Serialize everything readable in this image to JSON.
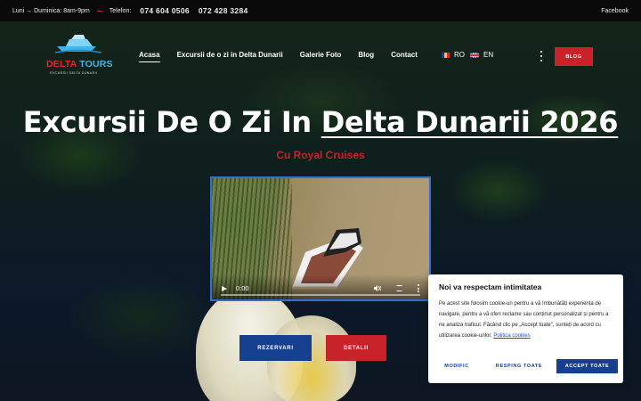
{
  "topbar": {
    "hours": "Luni → Duminica: 8am-9pm",
    "phone_label": "Telefon:",
    "phone1": "074 604 0506",
    "phone2": "072 428 3284",
    "facebook": "Facebook"
  },
  "logo": {
    "brand_part1": "DELTA",
    "brand_part2": "TOURS",
    "tagline": "EXCURSII DELTA DUNARII"
  },
  "nav": {
    "items": [
      {
        "label": "Acasa",
        "active": true
      },
      {
        "label": "Excursii de o zi in Delta Dunarii"
      },
      {
        "label": "Galerie Foto"
      },
      {
        "label": "Blog"
      },
      {
        "label": "Contact"
      }
    ]
  },
  "languages": [
    {
      "code": "RO",
      "flag": "ro-flag-icon"
    },
    {
      "code": "EN",
      "flag": "uk-flag-icon"
    }
  ],
  "header": {
    "cta_label": "BLOG"
  },
  "hero": {
    "title_plain": "Excursii De O Zi In ",
    "title_underlined": "Delta Dunarii 2026",
    "subtitle": "Cu Royal Cruises"
  },
  "video": {
    "time": "0:00"
  },
  "buttons": {
    "reserve": "REZERVARI",
    "details": "DETALII"
  },
  "cookie": {
    "title": "Noi va respectam intimitatea",
    "body": "Pe acest site folosim cookie-uri pentru a vă îmbunătăți experiența de navigare, pentru a vă oferi reclame sau conținut personalizat și pentru a ne analiza traficul. Făcând clic pe „Accept toate\", sunteți de acord cu utilizarea cookie-urilor.",
    "policy_link": "Politica cookies",
    "modify": "MODIFIC",
    "reject": "RESPING TOATE",
    "accept": "ACCEPT TOATE"
  },
  "colors": {
    "brand_red": "#c8232b",
    "brand_blue": "#173f8f",
    "accent_cyan": "#3fb5e8"
  }
}
